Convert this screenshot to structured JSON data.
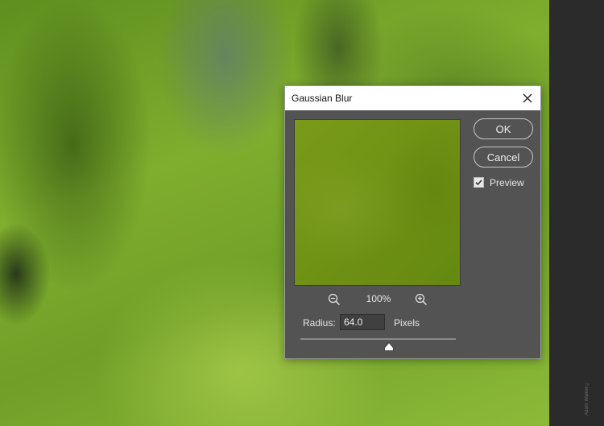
{
  "dialog": {
    "title": "Gaussian Blur",
    "ok_label": "OK",
    "cancel_label": "Cancel",
    "preview_label": "Preview",
    "preview_checked": true,
    "zoom_level": "100%",
    "radius_label": "Radius:",
    "radius_value": "64.0",
    "radius_unit": "Pixels",
    "slider_position": 0.57
  },
  "side_panel": {
    "caption": "Adam Walker ©"
  },
  "icons": {
    "close": "close-icon",
    "zoom_out": "zoom-out-icon",
    "zoom_in": "zoom-in-icon",
    "checkbox": "checkmark-icon",
    "slider_thumb": "triangle-thumb-icon"
  },
  "colors": {
    "dialog_bg": "#535353",
    "titlebar_bg": "#ffffff",
    "text": "#e6e6e6",
    "preview_green": "#6f9215"
  }
}
